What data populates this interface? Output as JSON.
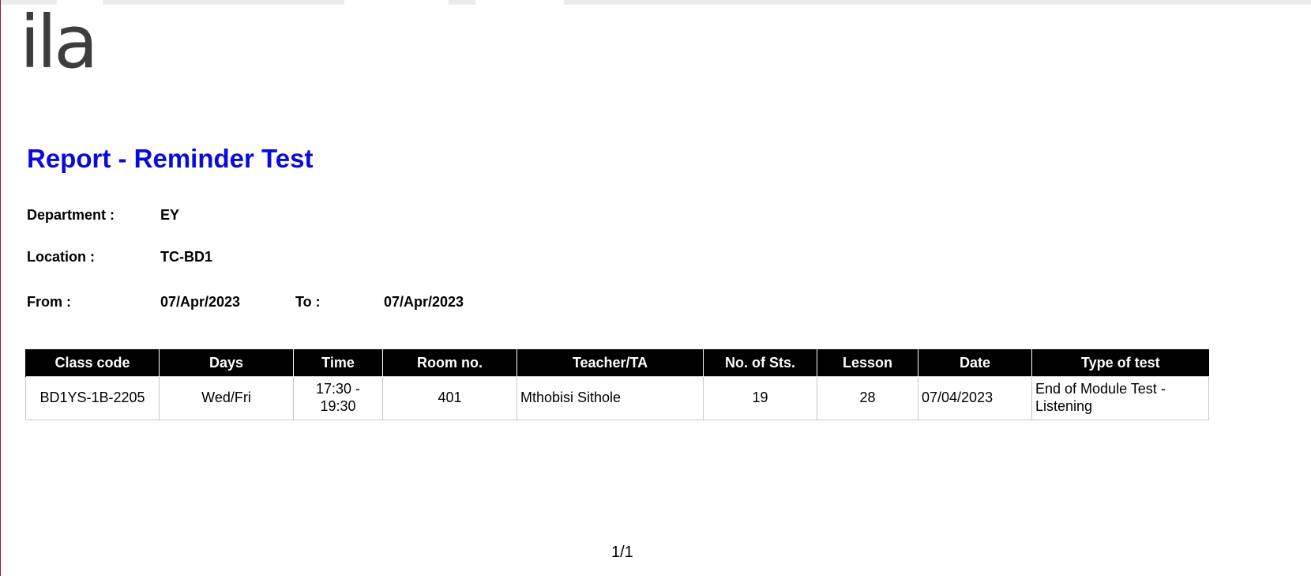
{
  "logo": {
    "text": "ila"
  },
  "report": {
    "title": "Report - Reminder Test",
    "department_label": "Department :",
    "department_value": "EY",
    "location_label": "Location :",
    "location_value": "TC-BD1",
    "from_label": "From :",
    "from_value": "07/Apr/2023",
    "to_label": "To :",
    "to_value": "07/Apr/2023"
  },
  "table": {
    "headers": [
      "Class code",
      "Days",
      "Time",
      "Room no.",
      "Teacher/TA",
      "No. of Sts.",
      "Lesson",
      "Date",
      "Type of test"
    ],
    "rows": [
      {
        "class_code": "BD1YS-1B-2205",
        "days": "Wed/Fri",
        "time_line1": "17:30 -",
        "time_line2": "19:30",
        "room": "401",
        "teacher": "Mthobisi Sithole",
        "students": "19",
        "lesson": "28",
        "date": "07/04/2023",
        "test_line1": "End of Module Test -",
        "test_line2": "Listening"
      }
    ]
  },
  "pager": {
    "text": "1/1"
  },
  "colors": {
    "title": "#0a0adb",
    "header_bg": "#000000",
    "logo": "#3d3d3d"
  }
}
